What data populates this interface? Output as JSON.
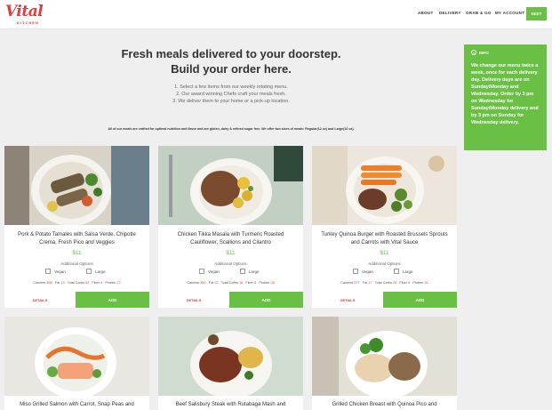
{
  "header": {
    "logo_text": "Vital",
    "logo_sub": "KITCHEN",
    "nav": [
      "ABOUT",
      "DELIVERY",
      "GRAB & GO",
      "MY ACCOUNT"
    ],
    "next_label": "NEXT",
    "accent": "#6abf45",
    "brand": "#e23b3b"
  },
  "hero": {
    "title_line1": "Fresh meals delivered to your doorstep.",
    "title_line2": "Build your order here.",
    "steps": [
      "1. Select a few items from our weekly rotating menu.",
      "2. Our award winning Chefs craft your meals fresh.",
      "3. We deliver them to your home or a pick-up location."
    ],
    "note": "All of our meals are crafted for optimal nutrition and flavor and are gluten, dairy & refined sugar free. We offer two sizes of meals: Regular(12 oz) and Large(16 oz)."
  },
  "info": {
    "heading": "INFO",
    "body": "We change our menu twice a week, once for each delivery day. Delivery days are on Sunday/Monday and Wednesday. Order by 3 pm on Wednesday for Sunday/Monday delivery and by 3 pm on Sunday for Wednesday delivery."
  },
  "common": {
    "additional_options": "Additional Options",
    "vegan": "Vegan",
    "large": "Large",
    "details": "DETAILS",
    "add": "ADD",
    "calories_label": "Calories",
    "fat_label": "Fat",
    "carbs_label": "Total Carbs",
    "fiber_label": "Fiber",
    "protein_label": "Protein"
  },
  "cards": [
    {
      "title": "Pork & Potato Tamales with Salsa Verde, Chipotle Crema, Fresh Pico and Veggies",
      "price": "$11",
      "calories": "398",
      "fat": "13",
      "carbs": "52",
      "fiber": "4",
      "protein": "27"
    },
    {
      "title": "Chicken Tikka Masala with Turmeric Roasted Cauliflower, Scallions and Cilantro",
      "price": "$11",
      "calories": "380",
      "fat": "22",
      "carbs": "16",
      "fiber": "5",
      "protein": "28"
    },
    {
      "title": "Turkey Quinoa Burger with Roasted Brussels Sprouts and Carrots with Vital Sauce",
      "price": "$11",
      "calories": "377",
      "fat": "17",
      "carbs": "25",
      "fiber": "6",
      "protein": "31"
    },
    {
      "title": "Miso Grilled Salmon with Carrot, Snap Peas and"
    },
    {
      "title": "Beef Salisbury Steak with Rutabaga Mash and"
    },
    {
      "title": "Grilled Chicken Breast with Quinoa Pico and"
    }
  ]
}
